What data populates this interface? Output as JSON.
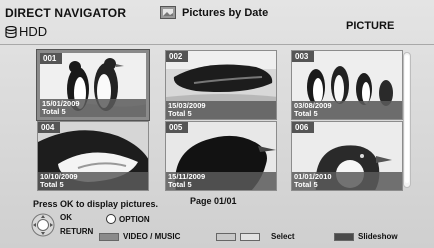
{
  "header": {
    "title": "DIRECT NAVIGATOR",
    "drive": "HDD",
    "mode": "Pictures by Date",
    "category": "PICTURE"
  },
  "thumbnails": [
    {
      "num": "001",
      "date": "15/01/2009",
      "total": "Total 5",
      "subject": "penguins-standing"
    },
    {
      "num": "002",
      "date": "15/03/2009",
      "total": "Total 5",
      "subject": "penguin-swimming"
    },
    {
      "num": "003",
      "date": "03/08/2009",
      "total": "Total 5",
      "subject": "penguins-group"
    },
    {
      "num": "004",
      "date": "10/10/2009",
      "total": "Total 5",
      "subject": "penguin-closeup"
    },
    {
      "num": "005",
      "date": "15/11/2009",
      "total": "Total 5",
      "subject": "penguin-silhouette"
    },
    {
      "num": "006",
      "date": "01/01/2010",
      "total": "Total 5",
      "subject": "penguin-head"
    }
  ],
  "footer": {
    "hint": "Press OK to display pictures.",
    "page": "Page 01/01",
    "ok_label": "OK",
    "return_label": "RETURN",
    "option_label": "OPTION",
    "video_music_label": "VIDEO / MUSIC",
    "select_label": "Select",
    "slideshow_label": "Slideshow"
  },
  "colors": {
    "key_gray": "#8a8a8a",
    "key_light": "#c8c8c8",
    "key_lighter": "#e2e2e2",
    "key_dark": "#4a4a4a"
  }
}
